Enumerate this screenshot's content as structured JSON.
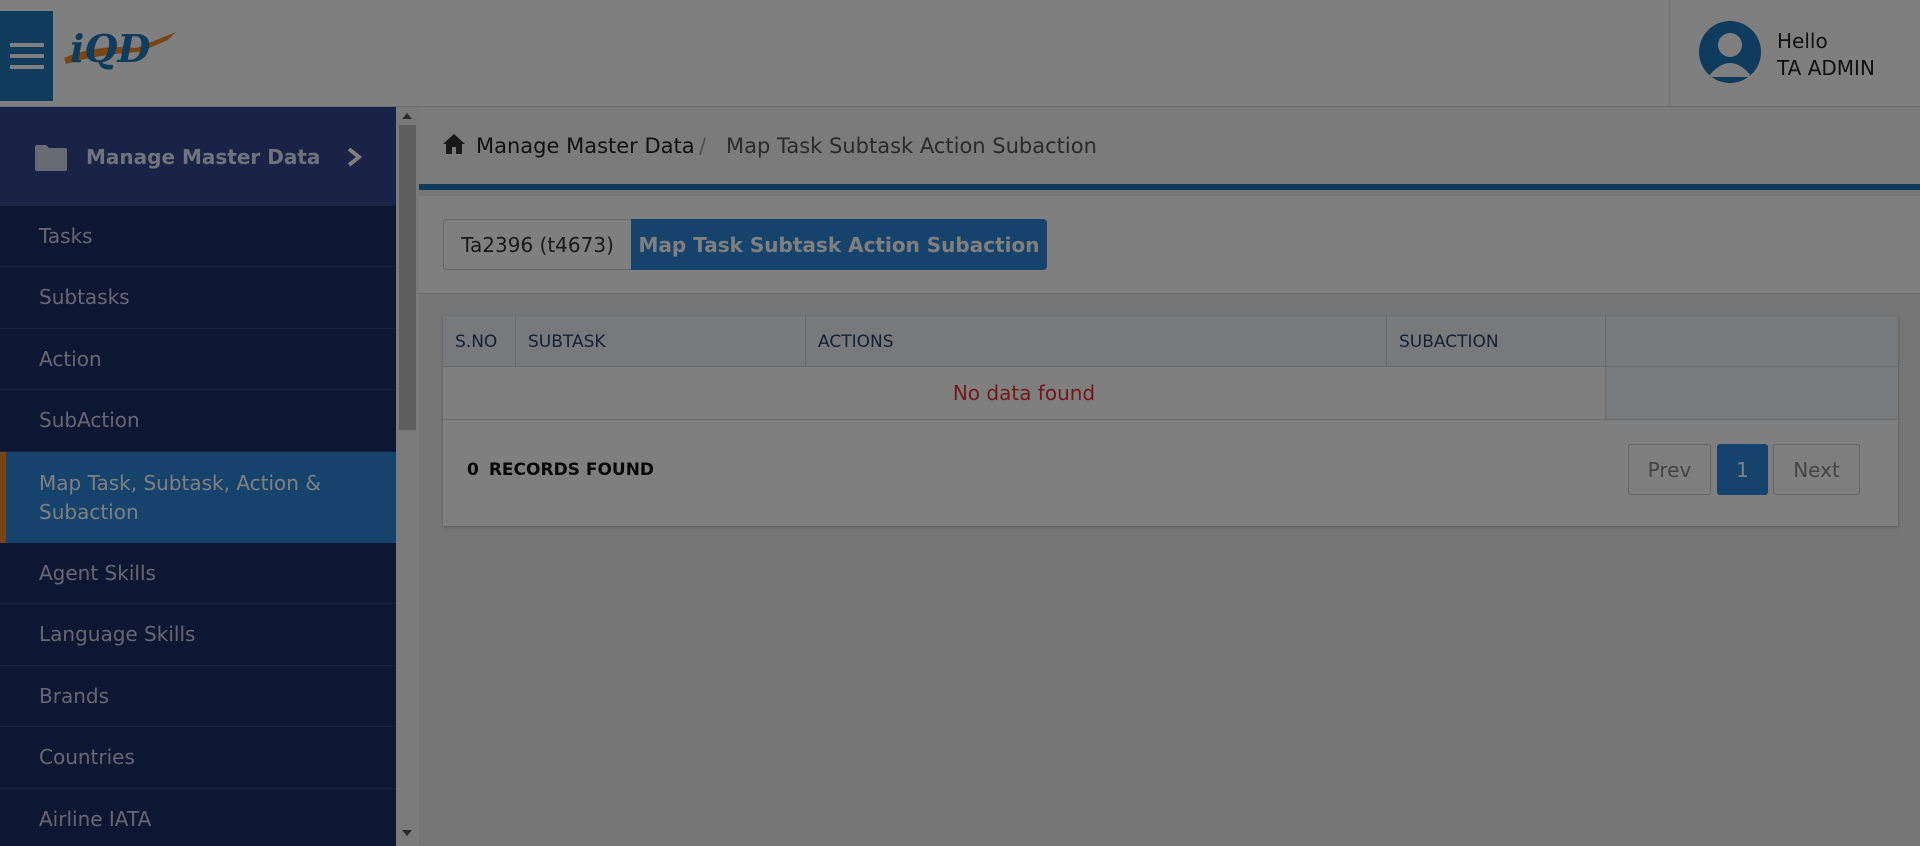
{
  "header": {
    "logo_text": "iQD",
    "greeting": "Hello",
    "username": "TA ADMIN"
  },
  "sidebar": {
    "section_title": "Manage Master Data",
    "items": [
      {
        "label": "Tasks"
      },
      {
        "label": "Subtasks"
      },
      {
        "label": "Action"
      },
      {
        "label": "SubAction"
      },
      {
        "label": "Map Task, Subtask, Action & Subaction",
        "active": true
      },
      {
        "label": "Agent Skills"
      },
      {
        "label": "Language Skills"
      },
      {
        "label": "Brands"
      },
      {
        "label": "Countries"
      },
      {
        "label": "Airline IATA"
      }
    ]
  },
  "breadcrumb": {
    "home_label": "Manage Master Data",
    "separator": "/",
    "current": "Map Task Subtask Action Subaction"
  },
  "tabs": [
    {
      "label": "Ta2396 (t4673)"
    },
    {
      "label": "Map Task Subtask Action Subaction",
      "active": true
    }
  ],
  "table": {
    "columns": [
      "S.NO",
      "SUBTASK",
      "ACTIONS",
      "SUBACTION"
    ],
    "empty_message": "No data found",
    "records_count": "0",
    "records_label": "RECORDS FOUND"
  },
  "pagination": {
    "prev": "Prev",
    "current_page": "1",
    "next": "Next"
  },
  "colors": {
    "primary": "#2a87d8",
    "sidebar_bg": "#1d2f63",
    "accent": "#f08c2c",
    "error": "#e53030"
  }
}
